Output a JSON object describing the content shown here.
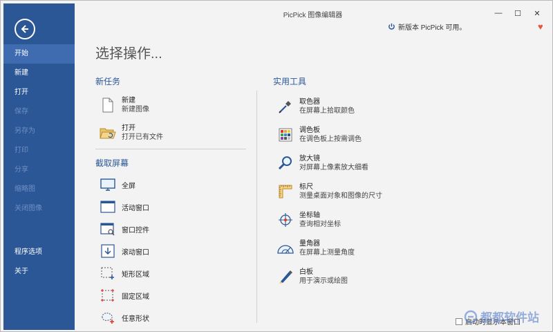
{
  "window": {
    "title": "PicPick 图像编辑器",
    "minimize": "—",
    "maximize": "☐",
    "close": "✕"
  },
  "header": {
    "update_text": "新版本 PicPick 可用。"
  },
  "sidebar": {
    "items": [
      {
        "label": "开始",
        "state": "active"
      },
      {
        "label": "新建",
        "state": "enabled"
      },
      {
        "label": "打开",
        "state": "enabled"
      },
      {
        "label": "保存",
        "state": "disabled"
      },
      {
        "label": "另存为",
        "state": "disabled"
      },
      {
        "label": "打印",
        "state": "disabled"
      },
      {
        "label": "分享",
        "state": "disabled"
      },
      {
        "label": "缩略图",
        "state": "disabled"
      },
      {
        "label": "关闭图像",
        "state": "disabled"
      }
    ],
    "bottom_items": [
      {
        "label": "程序选项"
      },
      {
        "label": "关于"
      }
    ]
  },
  "main": {
    "page_title": "选择操作...",
    "new_task": {
      "title": "新任务",
      "items": [
        {
          "label": "新建",
          "desc": "新建图像",
          "icon": "new-document-icon"
        },
        {
          "label": "打开",
          "desc": "打开已有文件",
          "icon": "open-folder-icon"
        }
      ]
    },
    "capture": {
      "title": "截取屏幕",
      "items": [
        {
          "label": "全屏",
          "icon": "monitor-icon"
        },
        {
          "label": "活动窗口",
          "icon": "active-window-icon"
        },
        {
          "label": "窗口控件",
          "icon": "window-control-icon"
        },
        {
          "label": "滚动窗口",
          "icon": "scroll-window-icon"
        },
        {
          "label": "矩形区域",
          "icon": "rectangle-region-icon"
        },
        {
          "label": "固定区域",
          "icon": "fixed-region-icon"
        },
        {
          "label": "任意形状",
          "icon": "freehand-shape-icon"
        }
      ]
    },
    "tools": {
      "title": "实用工具",
      "items": [
        {
          "label": "取色器",
          "desc": "在屏幕上拾取颜色",
          "icon": "eyedropper-icon"
        },
        {
          "label": "调色板",
          "desc": "在调色板上按需调色",
          "icon": "palette-icon"
        },
        {
          "label": "放大镜",
          "desc": "对屏幕上像素放大细看",
          "icon": "magnifier-icon"
        },
        {
          "label": "标尺",
          "desc": "测量桌面对象和图像的尺寸",
          "icon": "ruler-icon"
        },
        {
          "label": "坐标轴",
          "desc": "查询相对坐标",
          "icon": "crosshair-icon"
        },
        {
          "label": "量角器",
          "desc": "在屏幕上测量角度",
          "icon": "protractor-icon"
        },
        {
          "label": "白板",
          "desc": "用于演示或绘图",
          "icon": "whiteboard-pen-icon"
        }
      ]
    }
  },
  "footer": {
    "checkbox_label": "启动时显示本窗口",
    "checked": false
  },
  "watermark": {
    "text": "都都软件站"
  }
}
